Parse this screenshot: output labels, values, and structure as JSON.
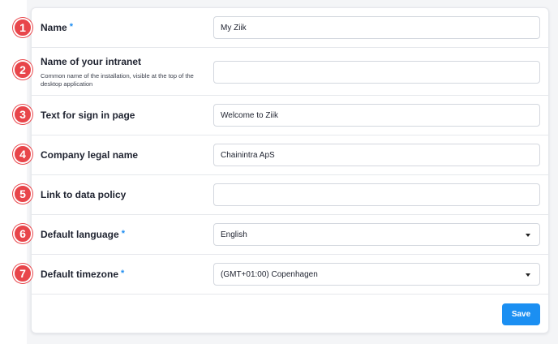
{
  "form": {
    "fields": [
      {
        "number": "1",
        "label": "Name",
        "required": "*",
        "value": "My Ziik"
      },
      {
        "number": "2",
        "label": "Name of your intranet",
        "description": "Common name of the installation, visible at the top of the desktop application",
        "value": ""
      },
      {
        "number": "3",
        "label": "Text for sign in page",
        "value": "Welcome to Ziik"
      },
      {
        "number": "4",
        "label": "Company legal name",
        "value": "Chainintra ApS"
      },
      {
        "number": "5",
        "label": "Link to data policy",
        "value": ""
      },
      {
        "number": "6",
        "label": "Default language",
        "required": "*",
        "selected": "English"
      },
      {
        "number": "7",
        "label": "Default timezone",
        "required": "*",
        "selected": "(GMT+01:00) Copenhagen"
      }
    ],
    "save_label": "Save"
  },
  "colors": {
    "step_badge": "#e8454a",
    "required_marker": "#1f8ef1",
    "save_button": "#1b8ff2"
  }
}
